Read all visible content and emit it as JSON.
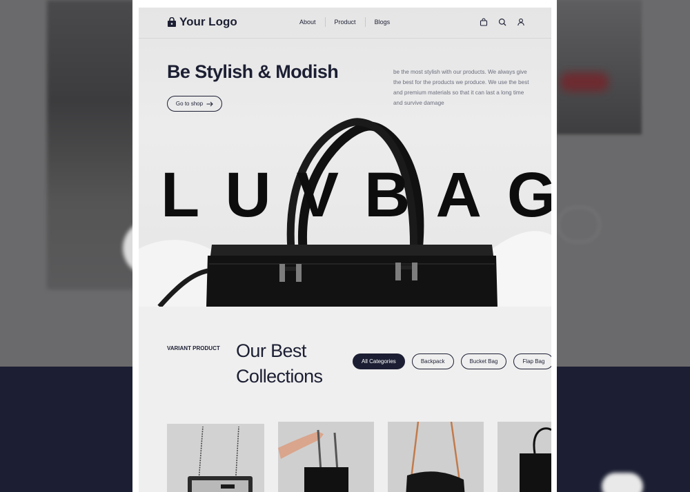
{
  "nav": {
    "logo_text": "Your Logo",
    "links": [
      "About",
      "Product",
      "Blogs"
    ],
    "icons": [
      "shopping-bag-icon",
      "search-icon",
      "user-icon"
    ]
  },
  "hero": {
    "title": "Be Stylish & Modish",
    "cta_label": "Go to shop",
    "description": "be the most stylish with our products. We always give the best for the products we produce. We use the best and premium materials so that it can last a long time and survive damage",
    "brand_word": "LUVBAG"
  },
  "collection": {
    "tag": "VARIANT PRODUCT",
    "title_line1": "Our Best",
    "title_line2": "Collections",
    "filters": [
      "All Categories",
      "Backpack",
      "Bucket Bag",
      "Flap Bag"
    ],
    "active_filter": "All Categories"
  },
  "colors": {
    "navy": "#1c1f33",
    "hero_bg": "#e8e8e8",
    "page_bg": "#efefef"
  }
}
